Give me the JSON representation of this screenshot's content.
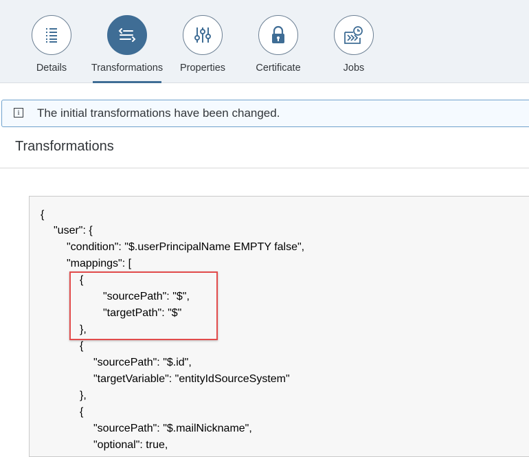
{
  "nav": {
    "items": [
      {
        "label": "Details",
        "icon": "list-icon",
        "active": false
      },
      {
        "label": "Transformations",
        "icon": "transformations-icon",
        "active": true
      },
      {
        "label": "Properties",
        "icon": "sliders-icon",
        "active": false
      },
      {
        "label": "Certificate",
        "icon": "lock-icon",
        "active": false
      },
      {
        "label": "Jobs",
        "icon": "jobs-icon",
        "active": false
      }
    ]
  },
  "info": {
    "message": "The initial transformations have been changed."
  },
  "section": {
    "title": "Transformations"
  },
  "code": {
    "lines": [
      "{",
      "\"user\": {",
      "\"condition\": \"$.userPrincipalName EMPTY false\",",
      "\"mappings\": [",
      "{",
      "\"sourcePath\": \"$\",",
      "\"targetPath\": \"$\"",
      "},",
      "{",
      "\"sourcePath\": \"$.id\",",
      "\"targetVariable\": \"entityIdSourceSystem\"",
      "},",
      "{",
      "\"sourcePath\": \"$.mailNickname\",",
      "\"optional\": true,"
    ]
  },
  "colors": {
    "accent": "#3f6d95",
    "highlight": "#e24b4b",
    "info_border": "#6ea1cc"
  }
}
